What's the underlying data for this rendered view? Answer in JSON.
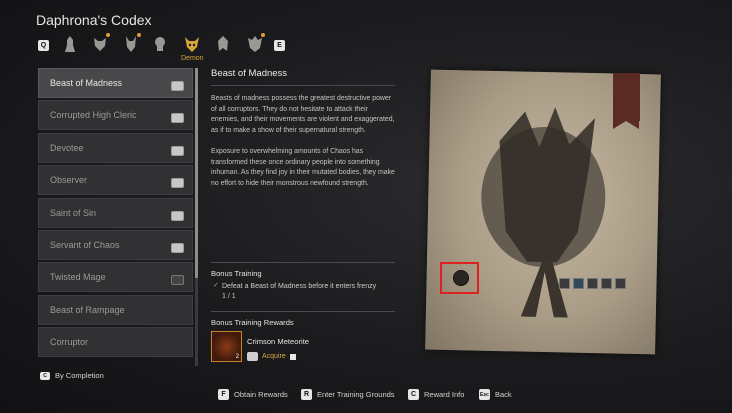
{
  "title": "Daphrona's Codex",
  "keys": {
    "prev": "Q",
    "next": "E",
    "back": "Esc",
    "f": "F",
    "r": "R",
    "c": "C",
    "esc": "Esc"
  },
  "selected_category": "Demon",
  "codex_list": [
    {
      "label": "Beast of Madness"
    },
    {
      "label": "Corrupted High Cleric"
    },
    {
      "label": "Devotee"
    },
    {
      "label": "Observer"
    },
    {
      "label": "Saint of Sin"
    },
    {
      "label": "Servant of Chaos"
    },
    {
      "label": "Twisted Mage"
    },
    {
      "label": "Beast of Rampage"
    },
    {
      "label": "Corruptor"
    }
  ],
  "detail": {
    "title": "Beast of Madness",
    "paragraph1": "Beasts of madness possess the greatest destructive power of all corruptors. They do not hesitate to attack their enemies, and their movements are violent and exaggerated, as if to make a show of their supernatural strength.",
    "paragraph2": "Exposure to overwhelming amounts of Chaos has transformed these once ordinary people into something inhuman. As they find joy in their mutated bodies, they make no effort to hide their monstrous newfound strength.",
    "bonus_training_label": "Bonus Training",
    "objective": "Defeat a Beast of Madness before it enters frenzy",
    "progress": "1 / 1",
    "rewards_label": "Bonus Training Rewards",
    "reward_name": "Crimson Meteorite",
    "reward_count": "2",
    "acquire_label": "Acquire"
  },
  "sort_label": "By Completion",
  "footer": {
    "obtain": "Obtain Rewards",
    "enter": "Enter Training Grounds",
    "info": "Reward Info",
    "back": "Back"
  },
  "colors": {
    "accent": "#d7a43a",
    "highlight_box": "#e02020"
  }
}
